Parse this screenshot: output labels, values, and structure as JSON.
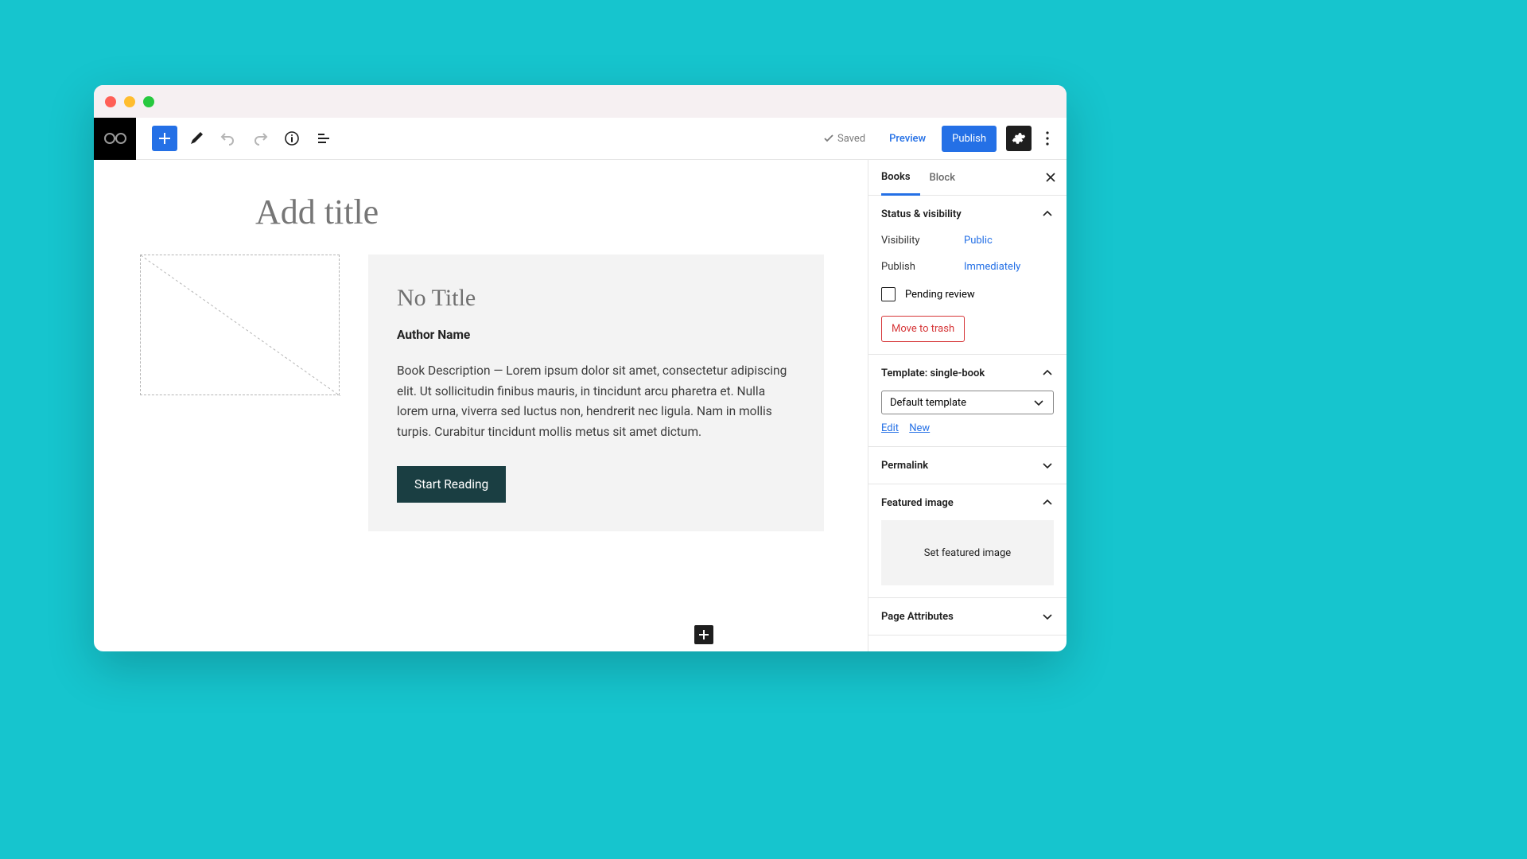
{
  "toolbar": {
    "saved_label": "Saved",
    "preview_label": "Preview",
    "publish_label": "Publish"
  },
  "editor": {
    "title_placeholder": "Add title",
    "card": {
      "title": "No Title",
      "author": "Author Name",
      "description": "Book Description — Lorem ipsum dolor sit amet, consectetur adipiscing elit. Ut sollicitudin finibus mauris, in tincidunt arcu pharetra et. Nulla lorem urna, viverra sed luctus non, hendrerit nec ligula. Nam in mollis turpis. Curabitur tincidunt mollis metus sit amet dictum.",
      "cta_label": "Start Reading"
    }
  },
  "sidebar": {
    "tabs": {
      "primary": "Books",
      "secondary": "Block"
    },
    "status": {
      "heading": "Status & visibility",
      "visibility_label": "Visibility",
      "visibility_value": "Public",
      "publish_label": "Publish",
      "publish_value": "Immediately",
      "pending_label": "Pending review",
      "trash_label": "Move to trash"
    },
    "template": {
      "heading": "Template: single-book",
      "selected": "Default template",
      "edit_label": "Edit",
      "new_label": "New"
    },
    "permalink_heading": "Permalink",
    "featured": {
      "heading": "Featured image",
      "placeholder": "Set featured image"
    },
    "page_attributes_heading": "Page Attributes"
  }
}
